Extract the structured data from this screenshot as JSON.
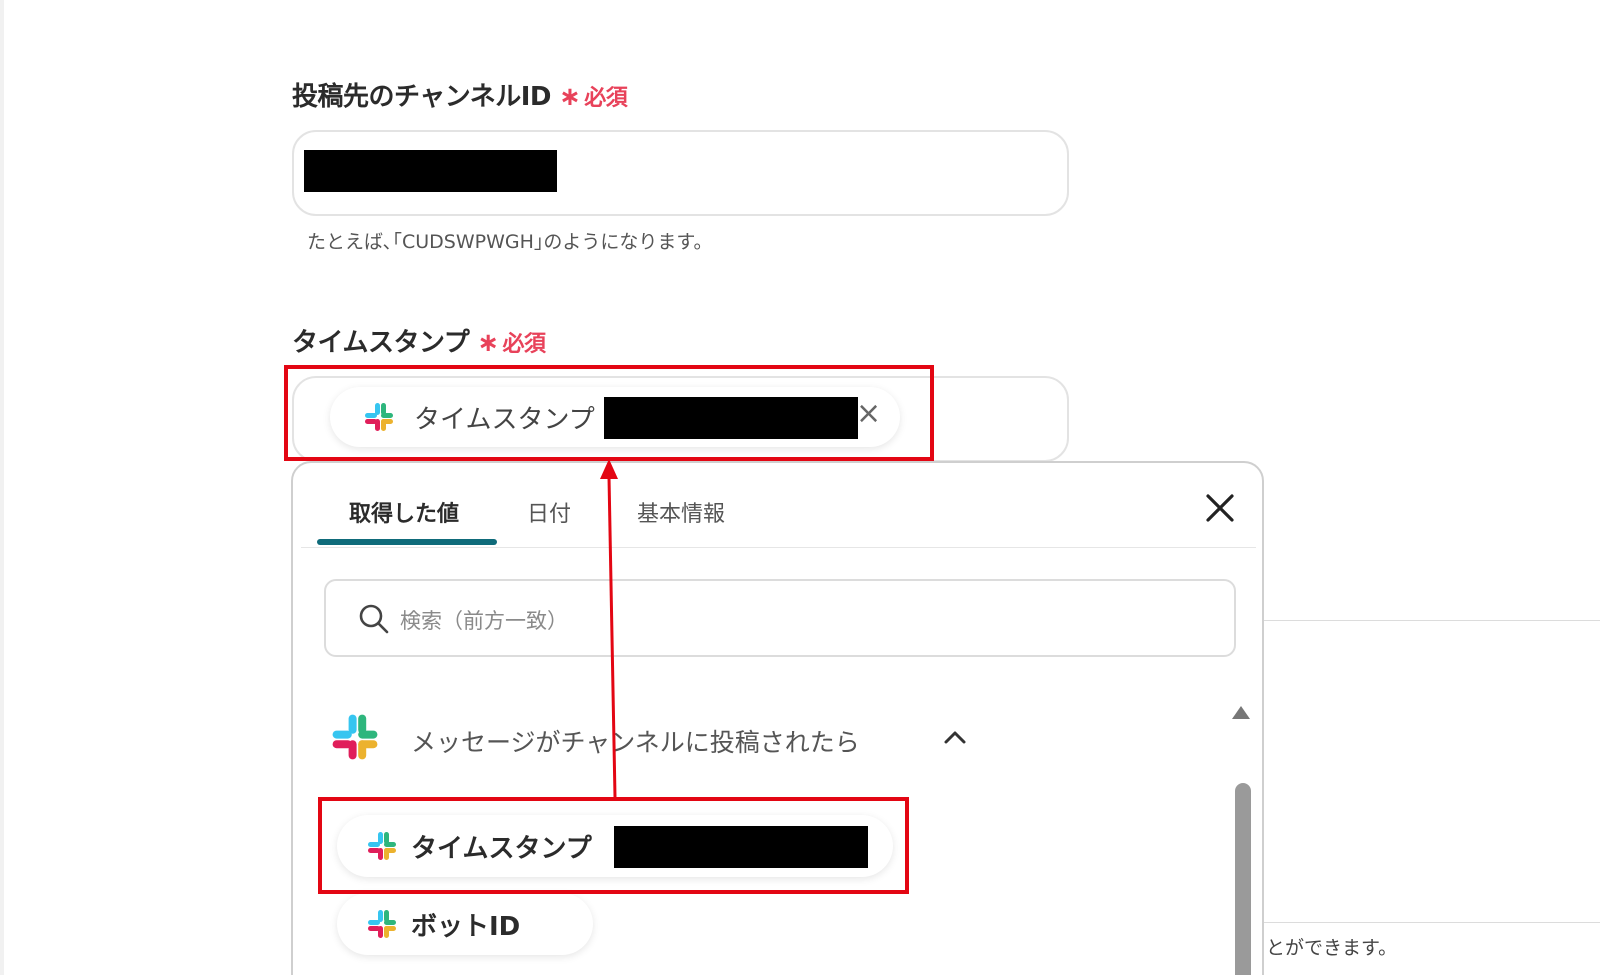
{
  "channel_field": {
    "label": "投稿先のチャンネルID",
    "required_mark": "∗",
    "required_text": "必須",
    "hint": "たとえば､｢CUDSWPWGH｣のようになります。"
  },
  "timestamp_field": {
    "label": "タイムスタンプ",
    "required_mark": "∗",
    "required_text": "必須",
    "chip_label": "タイムスタンプ",
    "chip_remove": "×"
  },
  "picker": {
    "tabs": [
      {
        "label": "取得した値",
        "active": true
      },
      {
        "label": "日付",
        "active": false
      },
      {
        "label": "基本情報",
        "active": false
      }
    ],
    "search_placeholder": "検索（前方一致）",
    "group_title": "メッセージがチャンネルに投稿されたら",
    "items": [
      {
        "label": "タイムスタンプ"
      },
      {
        "label": "ボットID"
      }
    ]
  },
  "background_hint": "とができます。",
  "colors": {
    "required": "#e8425a",
    "highlight": "#e30613",
    "tab_indicator": "#0f6b7a"
  },
  "icons": {
    "app_icon": "slack-icon",
    "search": "search-icon",
    "close": "close-icon",
    "collapse": "chevron-up-icon"
  }
}
